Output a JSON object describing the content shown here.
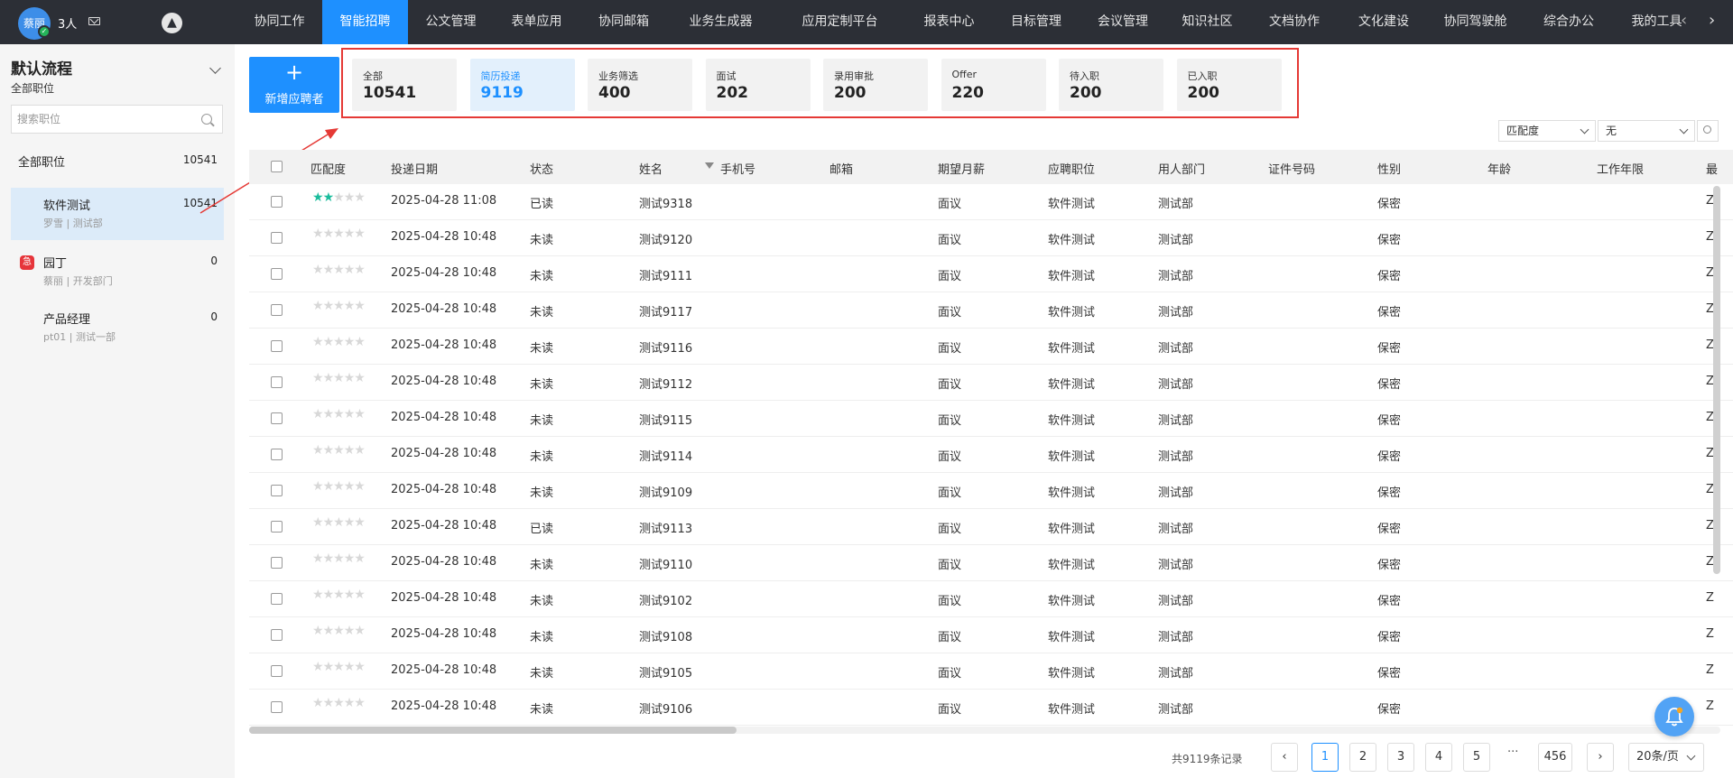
{
  "topbar": {
    "avatar_text": "蔡丽",
    "user_count": "3人",
    "nav": [
      "协同工作",
      "智能招聘",
      "公文管理",
      "表单应用",
      "协同邮箱",
      "业务生成器",
      "应用定制平台",
      "报表中心",
      "目标管理",
      "会议管理",
      "知识社区",
      "文档协作",
      "文化建设",
      "协同驾驶舱",
      "综合办公",
      "我的工具"
    ],
    "active_nav": "智能招聘"
  },
  "sidebar": {
    "flow_title": "默认流程",
    "flow_subtitle": "全部职位",
    "search_placeholder": "搜索职位",
    "all_positions": {
      "label": "全部职位",
      "count": "10541"
    },
    "positions": [
      {
        "name": "软件测试",
        "count": "10541",
        "meta": "罗雪 | 测试部",
        "selected": true
      },
      {
        "name": "园丁",
        "count": "0",
        "meta": "蔡丽 | 开发部门",
        "urgent": true,
        "urgent_label": "急"
      },
      {
        "name": "产品经理",
        "count": "0",
        "meta": "pt01 | 测试一部"
      }
    ]
  },
  "add_button": {
    "icon": "+",
    "label": "新增应聘者"
  },
  "stages": [
    {
      "label": "全部",
      "count": "10541"
    },
    {
      "label": "简历投递",
      "count": "9119",
      "active": true
    },
    {
      "label": "业务筛选",
      "count": "400"
    },
    {
      "label": "面试",
      "count": "202"
    },
    {
      "label": "录用审批",
      "count": "200"
    },
    {
      "label": "Offer",
      "count": "220"
    },
    {
      "label": "待入职",
      "count": "200"
    },
    {
      "label": "已入职",
      "count": "200"
    }
  ],
  "filters": {
    "sort_by": "匹配度",
    "value": "无"
  },
  "table": {
    "columns": [
      "匹配度",
      "投递日期",
      "状态",
      "姓名",
      "手机号",
      "邮箱",
      "期望月薪",
      "应聘职位",
      "用人部门",
      "证件号码",
      "性别",
      "年龄",
      "工作年限",
      "最"
    ],
    "rows": [
      {
        "rating": 2,
        "date": "2025-04-28 11:08",
        "status": "已读",
        "name": "测试9318",
        "salary": "面议",
        "position": "软件测试",
        "dept": "测试部",
        "gender": "保密",
        "cut": "Z"
      },
      {
        "rating": 0,
        "date": "2025-04-28 10:48",
        "status": "未读",
        "name": "测试9120",
        "salary": "面议",
        "position": "软件测试",
        "dept": "测试部",
        "gender": "保密",
        "cut": "Z"
      },
      {
        "rating": 0,
        "date": "2025-04-28 10:48",
        "status": "未读",
        "name": "测试9111",
        "salary": "面议",
        "position": "软件测试",
        "dept": "测试部",
        "gender": "保密",
        "cut": "Z"
      },
      {
        "rating": 0,
        "date": "2025-04-28 10:48",
        "status": "未读",
        "name": "测试9117",
        "salary": "面议",
        "position": "软件测试",
        "dept": "测试部",
        "gender": "保密",
        "cut": "Z"
      },
      {
        "rating": 0,
        "date": "2025-04-28 10:48",
        "status": "未读",
        "name": "测试9116",
        "salary": "面议",
        "position": "软件测试",
        "dept": "测试部",
        "gender": "保密",
        "cut": "Z"
      },
      {
        "rating": 0,
        "date": "2025-04-28 10:48",
        "status": "未读",
        "name": "测试9112",
        "salary": "面议",
        "position": "软件测试",
        "dept": "测试部",
        "gender": "保密",
        "cut": "Z"
      },
      {
        "rating": 0,
        "date": "2025-04-28 10:48",
        "status": "未读",
        "name": "测试9115",
        "salary": "面议",
        "position": "软件测试",
        "dept": "测试部",
        "gender": "保密",
        "cut": "Z"
      },
      {
        "rating": 0,
        "date": "2025-04-28 10:48",
        "status": "未读",
        "name": "测试9114",
        "salary": "面议",
        "position": "软件测试",
        "dept": "测试部",
        "gender": "保密",
        "cut": "Z"
      },
      {
        "rating": 0,
        "date": "2025-04-28 10:48",
        "status": "未读",
        "name": "测试9109",
        "salary": "面议",
        "position": "软件测试",
        "dept": "测试部",
        "gender": "保密",
        "cut": "Z"
      },
      {
        "rating": 0,
        "date": "2025-04-28 10:48",
        "status": "已读",
        "name": "测试9113",
        "salary": "面议",
        "position": "软件测试",
        "dept": "测试部",
        "gender": "保密",
        "cut": "Z"
      },
      {
        "rating": 0,
        "date": "2025-04-28 10:48",
        "status": "未读",
        "name": "测试9110",
        "salary": "面议",
        "position": "软件测试",
        "dept": "测试部",
        "gender": "保密",
        "cut": "Z"
      },
      {
        "rating": 0,
        "date": "2025-04-28 10:48",
        "status": "未读",
        "name": "测试9102",
        "salary": "面议",
        "position": "软件测试",
        "dept": "测试部",
        "gender": "保密",
        "cut": "Z"
      },
      {
        "rating": 0,
        "date": "2025-04-28 10:48",
        "status": "未读",
        "name": "测试9108",
        "salary": "面议",
        "position": "软件测试",
        "dept": "测试部",
        "gender": "保密",
        "cut": "Z"
      },
      {
        "rating": 0,
        "date": "2025-04-28 10:48",
        "status": "未读",
        "name": "测试9105",
        "salary": "面议",
        "position": "软件测试",
        "dept": "测试部",
        "gender": "保密",
        "cut": "Z"
      },
      {
        "rating": 0,
        "date": "2025-04-28 10:48",
        "status": "未读",
        "name": "测试9106",
        "salary": "面议",
        "position": "软件测试",
        "dept": "测试部",
        "gender": "保密",
        "cut": "Z"
      }
    ]
  },
  "pagination": {
    "total_text": "共9119条记录",
    "pages": [
      "1",
      "2",
      "3",
      "4",
      "5"
    ],
    "current": "1",
    "ellipsis": "···",
    "last_page": "456",
    "page_size": "20条/页"
  },
  "colors": {
    "accent": "#1e90ff",
    "topbar": "#2c2f36",
    "highlight": "#e53935",
    "star_on": "#1abc9c"
  }
}
